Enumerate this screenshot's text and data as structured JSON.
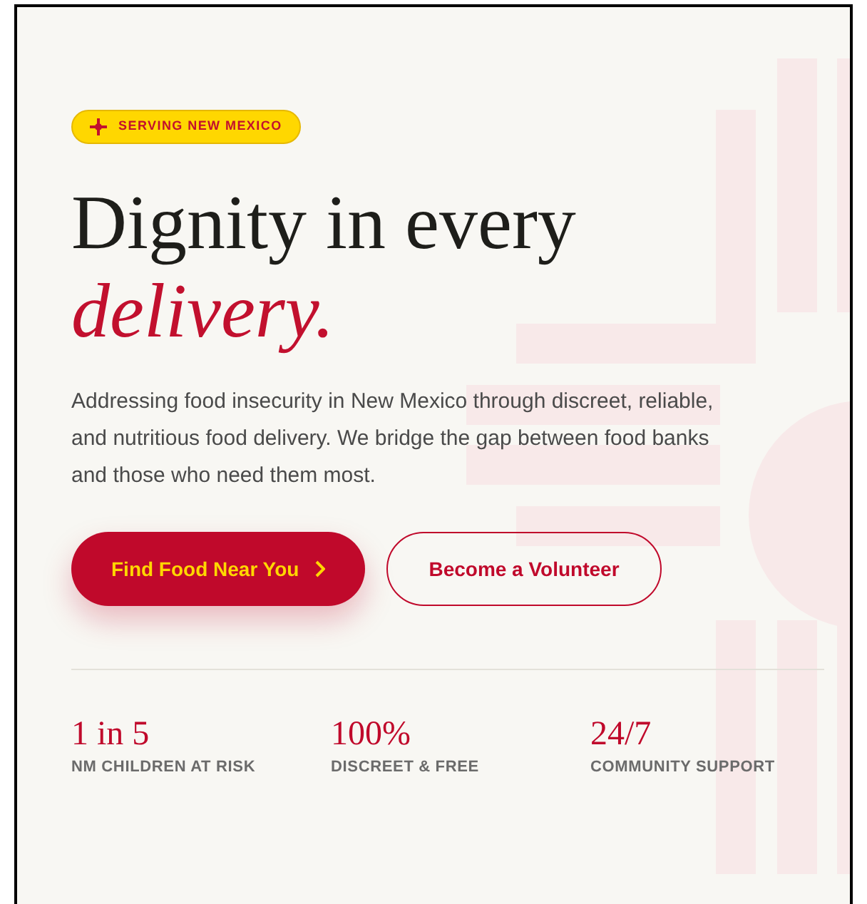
{
  "badge": {
    "label": "SERVING NEW MEXICO"
  },
  "headline": {
    "line_1": "Dignity in every",
    "line_2": "delivery."
  },
  "description": "Addressing food insecurity in New Mexico through discreet, reliable, and nutritious food delivery. We bridge the gap between food banks and those who need them most.",
  "buttons": [
    {
      "label": "Find Food Near You",
      "kind": "primary"
    },
    {
      "label": "Become a Volunteer",
      "kind": "outline"
    }
  ],
  "stats": [
    {
      "value": "1 in 5",
      "label": "NM CHILDREN AT RISK"
    },
    {
      "value": "100%",
      "label": "DISCREET & FREE"
    },
    {
      "value": "24/7",
      "label": "COMMUNITY SUPPORT"
    }
  ]
}
